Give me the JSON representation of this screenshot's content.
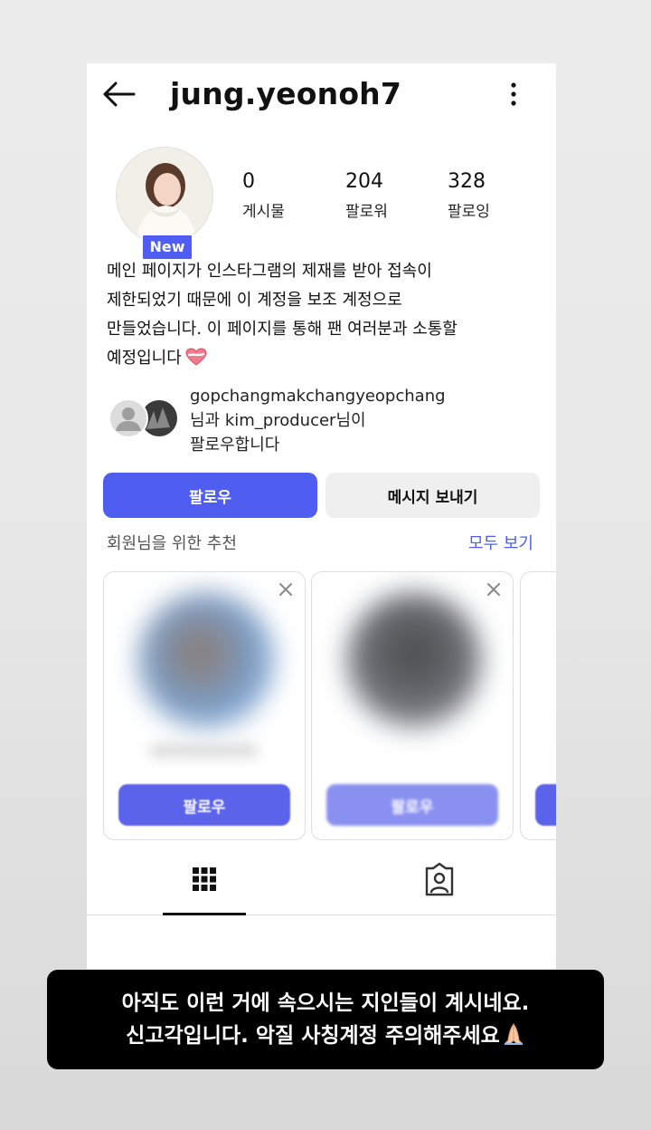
{
  "header": {
    "username": "jung.yeonoh7"
  },
  "profile": {
    "badge": "New",
    "stats": [
      {
        "value": "0",
        "label": "게시물"
      },
      {
        "value": "204",
        "label": "팔로워"
      },
      {
        "value": "328",
        "label": "팔로잉"
      }
    ],
    "bio_lines": [
      "메인 페이지가 인스타그램의 제재를 받아 접속이",
      "제한되었기 때문에 이 계정을 보조 계정으로",
      "만들었습니다. 이 페이지를 통해 팬 여러분과 소통할",
      "예정입니다"
    ],
    "mutual_lines": [
      "gopchangmakchangyeopchang",
      "님과 kim_producer님이",
      "팔로우합니다"
    ]
  },
  "actions": {
    "follow_label": "팔로우",
    "message_label": "메시지 보내기"
  },
  "suggestions": {
    "label": "회원님을 위한 추천",
    "see_all": "모두 보기",
    "cards": [
      {
        "follow_label": "팔로우"
      },
      {
        "follow_label": "팔로우"
      }
    ]
  },
  "tabs": {
    "grid_icon": "grid-icon",
    "tagged_icon": "tagged-person-icon"
  },
  "overlay": {
    "line1": "아직도 이런 거에 속으시는 지인들이 계시네요.",
    "line2": "신고각입니다. 악질 사칭계정 주의해주세요"
  },
  "colors": {
    "accent": "#4f5ef0",
    "secondary_button": "#efefef"
  }
}
